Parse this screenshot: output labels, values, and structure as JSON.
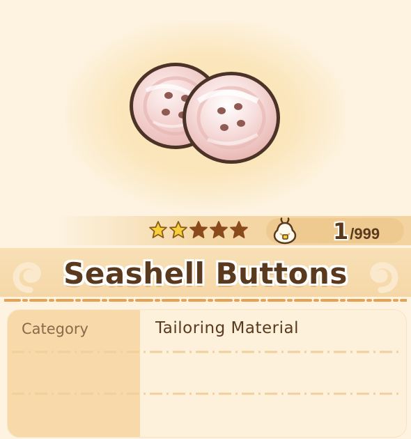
{
  "item": {
    "name": "Seashell Buttons",
    "icon": "seashell-buttons-icon",
    "rarity": {
      "filled": 2,
      "total": 5
    },
    "quantity": {
      "current": "1",
      "max": "/999"
    }
  },
  "details": {
    "rows": [
      {
        "label": "Category",
        "value": "Tailoring Material"
      },
      {
        "label": "",
        "value": ""
      },
      {
        "label": "",
        "value": ""
      }
    ]
  },
  "colors": {
    "background": "#fdf3e0",
    "text_dark": "#5a3a1e",
    "accent_band": "#f5d8a8",
    "star_filled": "#f6cf3a",
    "star_empty": "#8a4a1c",
    "dash": "#e5a253"
  }
}
